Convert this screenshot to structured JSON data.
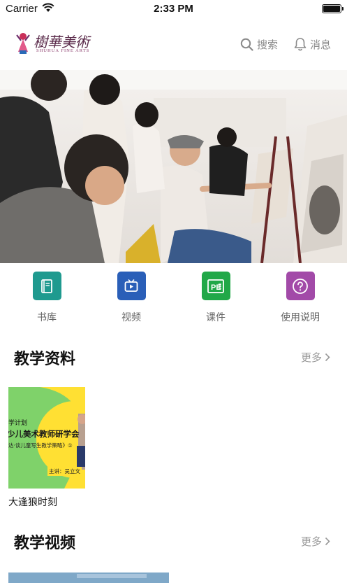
{
  "status_bar": {
    "carrier": "Carrier",
    "time": "2:33 PM",
    "battery_level": 1.0
  },
  "header": {
    "logo_text": "樹華美術",
    "logo_subtext": "SHUHUA FINE ARTS",
    "search_label": "搜索",
    "messages_label": "消息"
  },
  "quick_links": [
    {
      "label": "书库",
      "icon": "book-icon",
      "color": "#1f9a8f"
    },
    {
      "label": "视频",
      "icon": "tv-icon",
      "color": "#2a5fb8"
    },
    {
      "label": "课件",
      "icon": "ppt-icon",
      "color": "#21a848"
    },
    {
      "label": "使用说明",
      "icon": "help-icon",
      "color": "#a24aa8"
    }
  ],
  "teaching_materials": {
    "title": "教学资料",
    "more_label": "更多",
    "items": [
      {
        "caption": "大逢狼时刻",
        "thumb_lines": [
          "学计划",
          "少儿美术教师研学会",
          "达·谈儿童写生教学策略》①",
          "主讲：吴立文"
        ]
      }
    ]
  },
  "teaching_videos": {
    "title": "教学视频",
    "more_label": "更多"
  },
  "colors": {
    "accent_purple": "#5a2a4a",
    "muted": "#999999"
  }
}
